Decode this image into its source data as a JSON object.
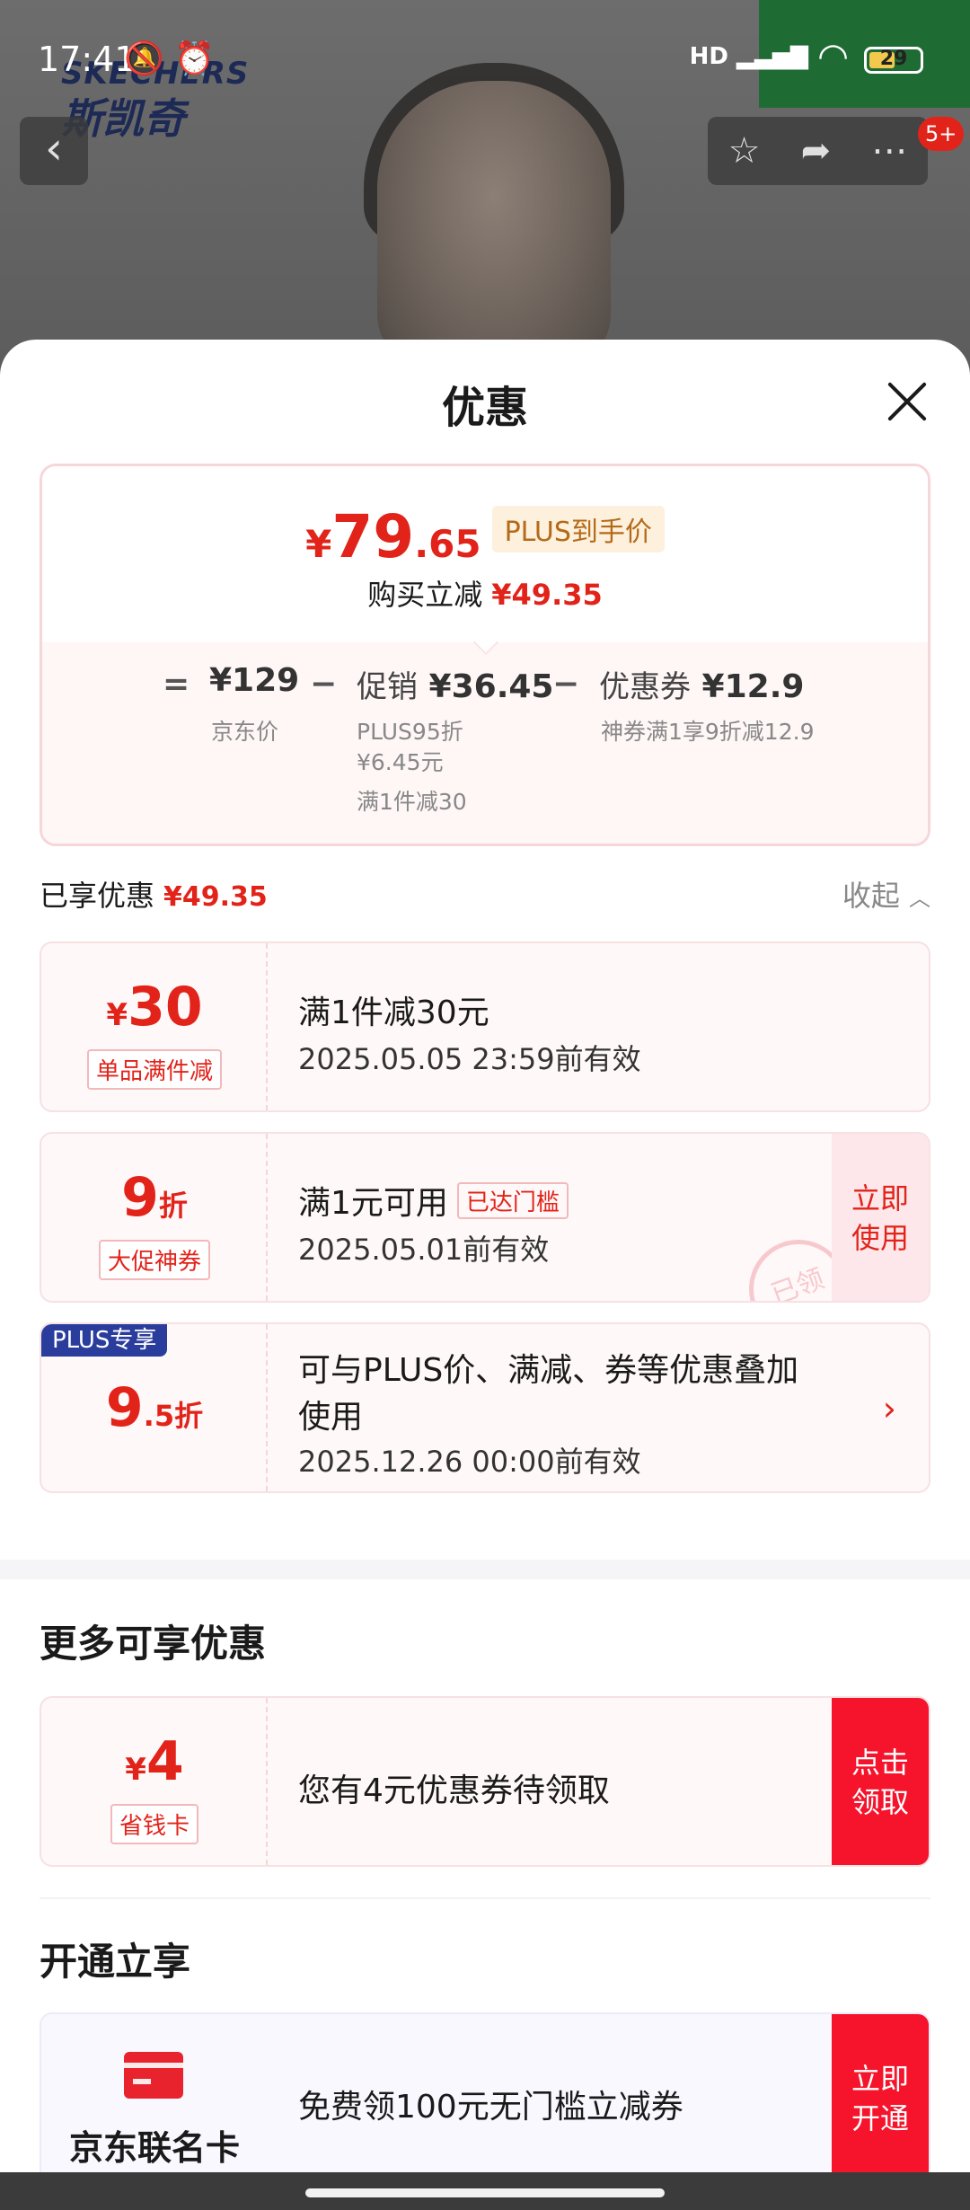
{
  "status_bar": {
    "time": "17:41",
    "network": "HD",
    "battery": "29"
  },
  "background": {
    "brand_en": "SKECHERS",
    "brand_cn": "斯凯奇",
    "notification_count": "5+"
  },
  "sheet": {
    "title": "优惠",
    "final_price": {
      "currency": "¥",
      "integer": "79",
      "decimal": ".65",
      "tag": "PLUS到手价"
    },
    "reduce": {
      "label": "购买立减",
      "amount": "¥49.35"
    },
    "breakdown": {
      "equals": "=",
      "minus": "−",
      "jd_price": "¥129",
      "jd_price_label": "京东价",
      "promo_label": "促销",
      "promo_value": "¥36.45",
      "promo_sub1": "PLUS95折",
      "promo_sub2": "¥6.45元",
      "promo_sub3": "满1件减30",
      "coupon_label": "优惠券",
      "coupon_value": "¥12.9",
      "coupon_sub": "神券满1享9折减12.9"
    },
    "enjoyed": {
      "label": "已享优惠",
      "amount": "¥49.35",
      "collapse": "收起"
    },
    "coupons": [
      {
        "currency": "¥",
        "value": "30",
        "tag": "单品满件减",
        "title": "满1件减30元",
        "date": "2025.05.05 23:59前有效"
      },
      {
        "value": "9",
        "unit": "折",
        "tag": "大促神券",
        "title": "满1元可用",
        "reached": "已达门槛",
        "date": "2025.05.01前有效",
        "btn_line1": "立即",
        "btn_line2": "使用",
        "stamp": "已领"
      },
      {
        "badge": "PLUS专享",
        "value": "9",
        "unit": ".5折",
        "title_line1": "可与PLUS价、满减、券等优惠叠加",
        "title_line2": "使用",
        "date": "2025.12.26 00:00前有效"
      }
    ],
    "more": {
      "title": "更多可享优惠",
      "card": {
        "currency": "¥",
        "value": "4",
        "tag": "省钱卡",
        "title": "您有4元优惠券待领取",
        "btn_line1": "点击",
        "btn_line2": "领取"
      }
    },
    "open": {
      "title": "开通立享",
      "card": {
        "name": "京东联名卡",
        "title": "免费领100元无门槛立减券",
        "btn_line1": "立即",
        "btn_line2": "开通"
      }
    }
  },
  "colors": {
    "accent_red": "#e2231a",
    "button_red": "#f5142b",
    "plus_blue": "#2a3d9d"
  }
}
